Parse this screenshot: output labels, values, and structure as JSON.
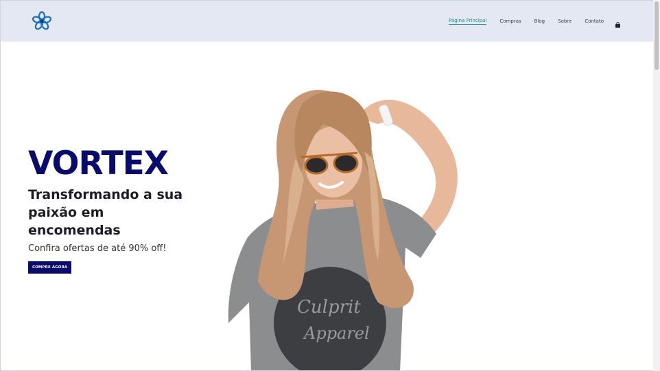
{
  "header": {
    "logo_icon": "flower-icon",
    "nav": [
      {
        "label": "Página Principal",
        "active": true
      },
      {
        "label": "Compras",
        "active": false
      },
      {
        "label": "Blog",
        "active": false
      },
      {
        "label": "Sobre",
        "active": false
      },
      {
        "label": "Contato",
        "active": false
      }
    ],
    "cart_icon": "shopping-bag-icon"
  },
  "hero": {
    "title": "VORTEX",
    "subtitle": "Transformando a sua paixão em encomendas",
    "offer": "Confira ofertas de até 90% off!",
    "cta_label": "COMPRE AGORA",
    "image_print": "Culprit Apparel"
  },
  "colors": {
    "header_bg": "#e4e8f3",
    "accent": "#1d8a8a",
    "brand": "#0b0b6b",
    "logo": "#1a6fb8"
  }
}
